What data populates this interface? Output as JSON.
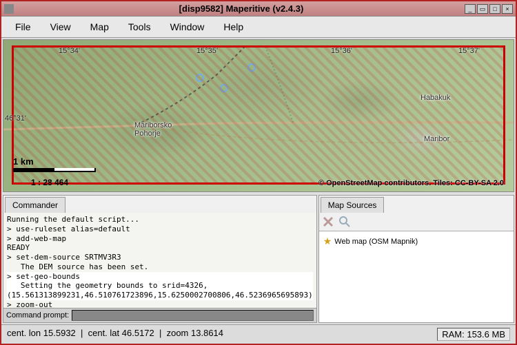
{
  "window": {
    "title": "[disp9582] Maperitive (v2.4.3)"
  },
  "menu": {
    "file": "File",
    "view": "View",
    "map": "Map",
    "tools": "Tools",
    "window": "Window",
    "help": "Help"
  },
  "map": {
    "lon_ticks": [
      "15°34'",
      "15°35'",
      "15°36'",
      "15°37'"
    ],
    "lat_ticks": [
      "46°31'"
    ],
    "places": {
      "pohorje": "Mariborsko\nPohorje",
      "habakuk": "Habakuk",
      "maribor": "Maribor"
    },
    "scale_distance": "1 km",
    "scale_ratio": "1 : 28 464",
    "attribution": "© OpenStreetMap contributors. Tiles: CC-BY-SA 2.0"
  },
  "commander": {
    "tab": "Commander",
    "lines": [
      "Running the default script...",
      "> use-ruleset alias=default",
      "> add-web-map",
      "READY",
      "> set-dem-source SRTMV3R3",
      "   The DEM source has been set.",
      "> set-geo-bounds",
      "   Setting the geometry bounds to srid=4326,",
      "(15.561313899231,46.510761723896,15.6250002700806,46.5236965695893)",
      "> zoom-out"
    ],
    "highlight_start": 6,
    "highlight_end": 8,
    "prompt_label": "Command prompt:"
  },
  "sources": {
    "tab": "Map Sources",
    "items": [
      {
        "label": "Web map (OSM Mapnik)"
      }
    ]
  },
  "status": {
    "center_lon_label": "cent. lon",
    "center_lon": "15.5932",
    "center_lat_label": "cent. lat",
    "center_lat": "46.5172",
    "zoom_label": "zoom",
    "zoom": "13.8614",
    "ram_label": "RAM:",
    "ram": "153.6 MB"
  }
}
